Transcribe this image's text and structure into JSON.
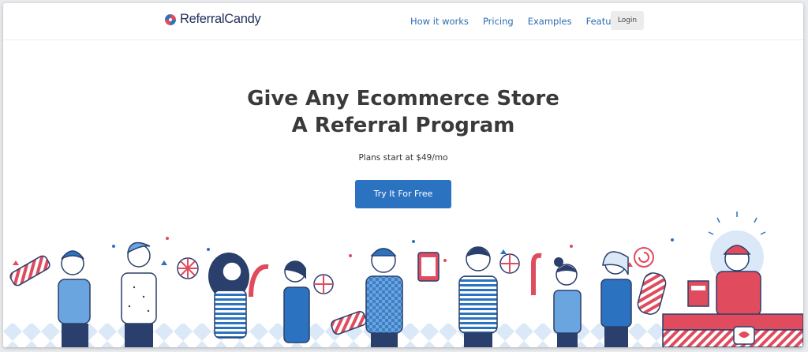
{
  "brand": {
    "name": "ReferralCandy"
  },
  "nav": {
    "links": [
      "How it works",
      "Pricing",
      "Examples",
      "Features"
    ],
    "login_label": "Login"
  },
  "hero": {
    "title_line1": "Give Any Ecommerce Store",
    "title_line2": "A Referral Program",
    "subtitle": "Plans start at $49/mo",
    "cta_label": "Try It For Free"
  },
  "colors": {
    "brand_blue": "#2b73c1",
    "link_blue": "#2c6db0",
    "candy_red": "#e04b5e",
    "figure_navy": "#2a3f6b",
    "background": "#ffffff"
  },
  "illustration": {
    "icon": "people-holding-candy-illustration"
  }
}
